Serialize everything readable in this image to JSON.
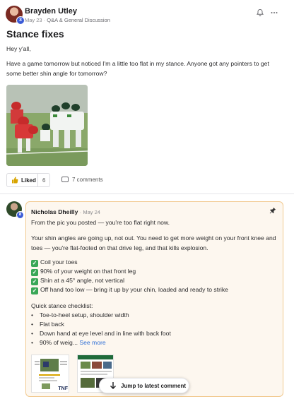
{
  "post": {
    "author": "Brayden Utley",
    "avatar_badge": "3",
    "date": "May 23",
    "separator": " · ",
    "category": "Q&A & General Discussion",
    "title": "Stance fixes",
    "greeting": "Hey y'all,",
    "body": "Have a game tomorrow but noticed I'm a little too flat in my stance. Anyone got any pointers to get some better shin angle for tomorrow?",
    "icons": {
      "notify": "bell-icon",
      "more": "more-dots-icon"
    }
  },
  "reactions": {
    "liked_label": "Liked",
    "like_count": "6",
    "comments_label": "7 comments"
  },
  "comment": {
    "author": "Nicholas Dheilly",
    "avatar_badge": "8",
    "date": "May 24",
    "intro": "From the pic you posted — you're too flat right now.",
    "paragraph": "Your shin angles are going up, not out. You need to get more weight on your front knee and toes — you're flat-footed on that drive leg, and that kills explosion.",
    "checks": [
      "Coil your toes",
      "90% of your weight on that front leg",
      "Shin at a 45° angle, not vertical",
      "Off hand too low — bring it up by your chin, loaded and ready to strike"
    ],
    "checklist_title": "Quick stance checklist:",
    "bullets": [
      "Toe-to-heel setup, shoulder width",
      "Flat back",
      "Down hand at eye level and in line with back foot"
    ],
    "truncated": "90% of weig...",
    "see_more": "See more",
    "thumb_logo": "TNF"
  },
  "jump": {
    "label": "Jump to latest comment"
  },
  "colors": {
    "accent": "#2f6fd6",
    "comment_border": "#f2c98f",
    "comment_bg": "#fdf7ef",
    "check_green": "#3aa757"
  }
}
